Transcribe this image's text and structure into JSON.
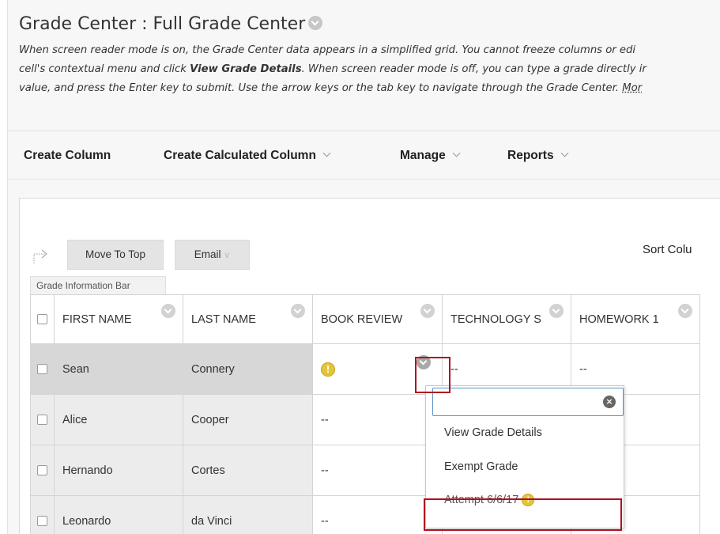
{
  "header": {
    "title": "Grade Center : Full Grade Center",
    "description_lines": [
      [
        "When screen reader mode is on, the Grade Center data appears in a simplified grid. You cannot freeze columns or edi"
      ],
      [
        "cell's contextual menu and click ",
        "View Grade Details",
        ". When screen reader mode is off, you can type a grade directly ir"
      ],
      [
        "value, and press the Enter key to submit. Use the arrow keys or the tab key to navigate through the Grade Center. ",
        "Mor"
      ]
    ]
  },
  "actions": {
    "create_column": "Create Column",
    "create_calculated": "Create Calculated Column",
    "manage": "Manage",
    "reports": "Reports"
  },
  "toolbar": {
    "move_to_top": "Move To Top",
    "email": "Email",
    "sort_columns": "Sort Colu"
  },
  "info_bar": "Grade Information Bar",
  "columns": {
    "first_name": "FIRST NAME",
    "last_name": "LAST NAME",
    "book_review": "BOOK REVIEW",
    "technology": "TECHNOLOGY S",
    "homework1": "HOMEWORK 1"
  },
  "rows": [
    {
      "first": "Sean",
      "last": "Connery",
      "book_review": "!",
      "technology": "--",
      "homework1": "--"
    },
    {
      "first": "Alice",
      "last": "Cooper",
      "book_review": "--"
    },
    {
      "first": "Hernando",
      "last": "Cortes",
      "book_review": "--"
    },
    {
      "first": "Leonardo",
      "last": "da Vinci",
      "book_review": "--"
    }
  ],
  "context_menu": {
    "search_value": "",
    "items": [
      "View Grade Details",
      "Exempt Grade",
      "Attempt 6/6/17"
    ]
  },
  "colors": {
    "highlight": "#b01020",
    "alert": "#e2c53a",
    "focus_border": "#5b92c8"
  }
}
